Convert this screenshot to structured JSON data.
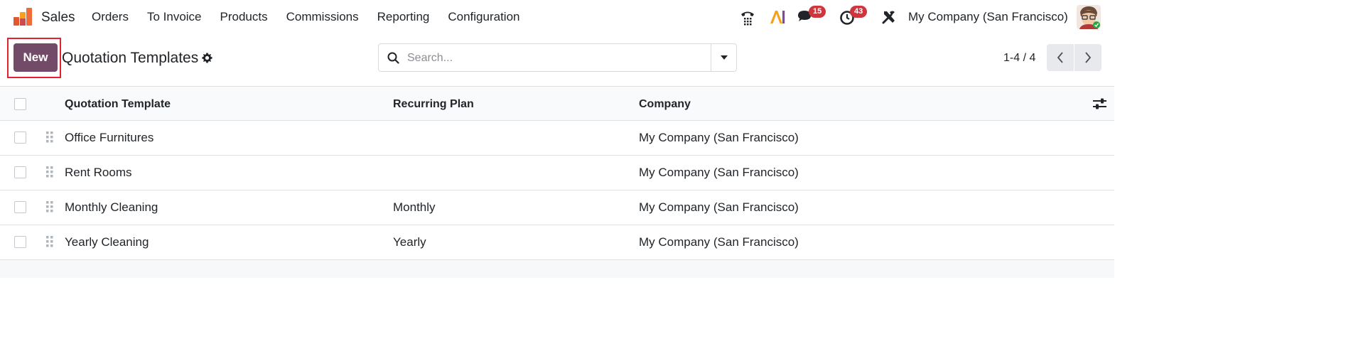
{
  "navbar": {
    "app_name": "Sales",
    "menu": [
      "Orders",
      "To Invoice",
      "Products",
      "Commissions",
      "Reporting",
      "Configuration"
    ],
    "messages_badge": "15",
    "activities_badge": "43",
    "company": "My Company (San Francisco)",
    "icons": [
      "sales-app-logo",
      "phone-icon",
      "ai-icon",
      "chat-icon",
      "clock-icon",
      "tools-icon",
      "avatar"
    ]
  },
  "control_panel": {
    "new_label": "New",
    "title": "Quotation Templates",
    "search_placeholder": "Search...",
    "pager": "1-4 / 4"
  },
  "list": {
    "columns": [
      "Quotation Template",
      "Recurring Plan",
      "Company"
    ],
    "rows": [
      {
        "name": "Office Furnitures",
        "plan": "",
        "company": "My Company (San Francisco)"
      },
      {
        "name": "Rent Rooms",
        "plan": "",
        "company": "My Company (San Francisco)"
      },
      {
        "name": "Monthly Cleaning",
        "plan": "Monthly",
        "company": "My Company (San Francisco)"
      },
      {
        "name": "Yearly Cleaning",
        "plan": "Yearly",
        "company": "My Company (San Francisco)"
      }
    ]
  },
  "colors": {
    "primary": "#714b67",
    "badge": "#d0343c",
    "highlight": "#e0232e"
  }
}
